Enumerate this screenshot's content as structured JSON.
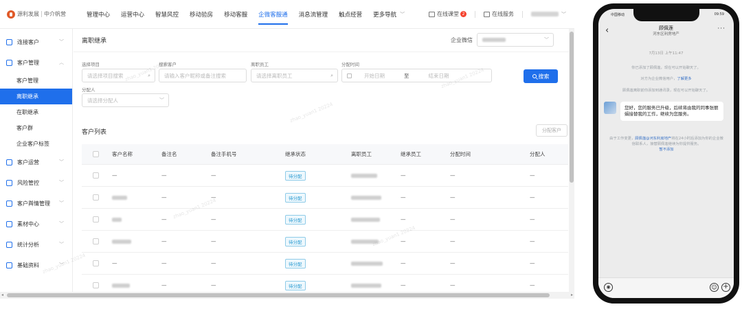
{
  "brand": {
    "name_a": "源利发展",
    "name_b": "中介帆营"
  },
  "nav": [
    {
      "label": "管理中心"
    },
    {
      "label": "运营中心"
    },
    {
      "label": "智慧风控"
    },
    {
      "label": "移动验房"
    },
    {
      "label": "移动客服"
    },
    {
      "label": "企微客服通",
      "active": true
    },
    {
      "label": "消息流管理"
    },
    {
      "label": "触点经营"
    },
    {
      "label": "更多导航"
    }
  ],
  "top_right": {
    "classroom": "在线课堂",
    "classroom_badge": "2",
    "service": "在线服务"
  },
  "sidebar": {
    "groups": [
      {
        "label": "连接客户",
        "icon": "link-icon"
      },
      {
        "label": "客户管理",
        "icon": "user-icon",
        "expanded": true,
        "children": [
          {
            "label": "客户管理"
          },
          {
            "label": "离职继承",
            "active": true
          },
          {
            "label": "在职继承"
          },
          {
            "label": "客户群"
          },
          {
            "label": "企业客户标签"
          }
        ]
      },
      {
        "label": "客户运营",
        "icon": "operation-icon"
      },
      {
        "label": "风险管控",
        "icon": "risk-icon"
      },
      {
        "label": "客户舆情管理",
        "icon": "opinion-icon"
      },
      {
        "label": "素材中心",
        "icon": "material-icon"
      },
      {
        "label": "统计分析",
        "icon": "chart-icon"
      },
      {
        "label": "基础资料",
        "icon": "data-icon"
      }
    ]
  },
  "page": {
    "title": "离职继承",
    "corp_label": "企业微信"
  },
  "filters": {
    "project_label": "选择项目",
    "project_placeholder": "请选择项目搜索",
    "customer_label": "搜索客户",
    "customer_placeholder": "请输入客户昵称或备注搜索",
    "resigned_label": "离职员工",
    "resigned_placeholder": "请选择离职员工",
    "time_label": "分配时间",
    "start_placeholder": "开始日期",
    "range_sep": "至",
    "end_placeholder": "结束日期",
    "assigner_label": "分配人",
    "assigner_placeholder": "请选择分配人",
    "search_button": "搜索"
  },
  "list": {
    "title": "客户列表",
    "assign_button": "分配客户",
    "columns": [
      "客户名称",
      "备注名",
      "备注手机号",
      "继承状态",
      "离职员工",
      "继承员工",
      "分配时间",
      "分配人"
    ],
    "rows": [
      {
        "name": "—",
        "remark": "—",
        "phone": "—",
        "status": "待分配",
        "heir": "—",
        "time": "—",
        "assigner": "—"
      },
      {
        "name": "",
        "remark": "—",
        "phone": "—",
        "status": "待分配",
        "heir": "—",
        "time": "—",
        "assigner": "—"
      },
      {
        "name": "",
        "remark": "—",
        "phone": "—",
        "status": "待分配",
        "heir": "—",
        "time": "—",
        "assigner": "—"
      },
      {
        "name": "",
        "remark": "—",
        "phone": "—",
        "status": "待分配",
        "heir": "—",
        "time": "—",
        "assigner": "—"
      },
      {
        "name": "—",
        "remark": "—",
        "phone": "—",
        "status": "待分配",
        "heir": "—",
        "time": "—",
        "assigner": "—"
      },
      {
        "name": "",
        "remark": "—",
        "phone": "—",
        "status": "待分配",
        "heir": "—",
        "time": "—",
        "assigner": "—"
      }
    ]
  },
  "phone": {
    "status_left": "中国移动",
    "status_right": "09:59",
    "chat_name": "顾佩莲",
    "chat_sub": "河东区利房地产",
    "time": "7月13日 上午11:47",
    "sys1": "你已添加了顾佩莲，现在可以开始聊天了。",
    "sys2a": "对方为企业微信用户，",
    "sys2b": "了解更多",
    "sys3": "顾佩莲离职前你添加到通讯录，现在可以开始聊天了。",
    "message": "您好，您的服务已升级，后续将由我的同事张丽娟接替我的工作，继续为您服务。",
    "notice_a": "由于工作变更，",
    "notice_b": "顾佩莲@河东利房地产",
    "notice_c": "将在24小时后添加为你的企业微信联系人，接替顾佩莲继续为你提供服务。",
    "notice_link": "暂不添加"
  },
  "colors": {
    "primary": "#1f6feb",
    "status_tag": "#2a9bd2",
    "brand": "#e05a29"
  }
}
